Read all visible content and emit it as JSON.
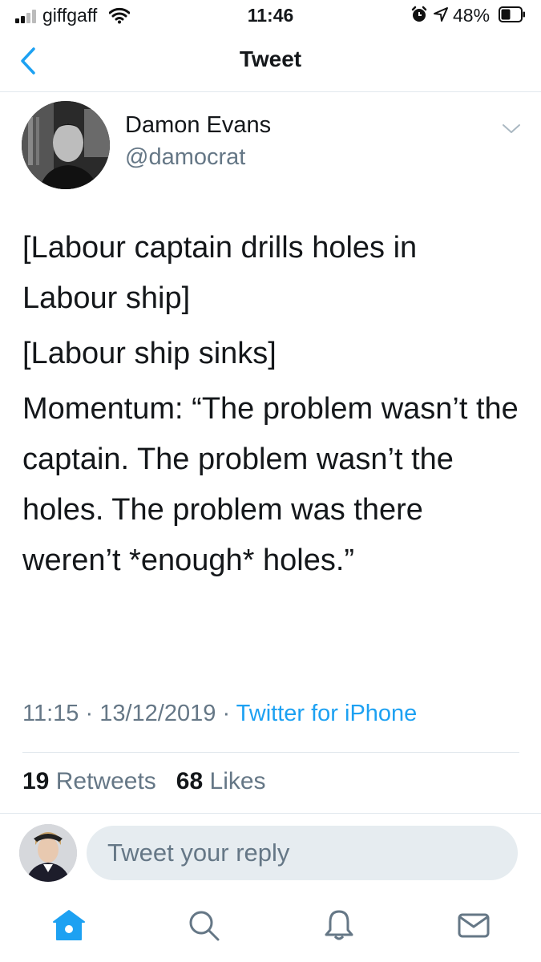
{
  "status_bar": {
    "carrier": "giffgaff",
    "time": "11:46",
    "battery_percent": "48%",
    "battery_level": 0.48,
    "icons": [
      "signal-icon",
      "wifi-icon",
      "alarm-icon",
      "location-arrow-icon",
      "battery-icon"
    ]
  },
  "nav": {
    "back_icon": "chevron-left-icon",
    "title": "Tweet"
  },
  "tweet": {
    "author_name": "Damon Evans",
    "author_handle": "@damocrat",
    "paragraphs": [
      "[Labour captain drills holes in Labour ship]",
      "[Labour ship sinks]",
      "Momentum: “The problem wasn’t the captain. The problem wasn’t the holes. The problem was there weren’t *enough* holes.”"
    ],
    "time": "11:15",
    "separator": "·",
    "date": "13/12/2019",
    "source": "Twitter for iPhone",
    "retweets_count": "19",
    "retweets_label": "Retweets",
    "likes_count": "68",
    "likes_label": "Likes"
  },
  "reply": {
    "placeholder": "Tweet your reply"
  },
  "tab_bar": {
    "items": [
      "home-icon",
      "search-icon",
      "notifications-icon",
      "messages-icon"
    ],
    "active": "home-icon"
  },
  "colors": {
    "accent": "#1da1f2",
    "text_primary": "#14171a",
    "text_secondary": "#657786",
    "divider": "#e1e8ed",
    "reply_bg": "#e6ecf0"
  }
}
